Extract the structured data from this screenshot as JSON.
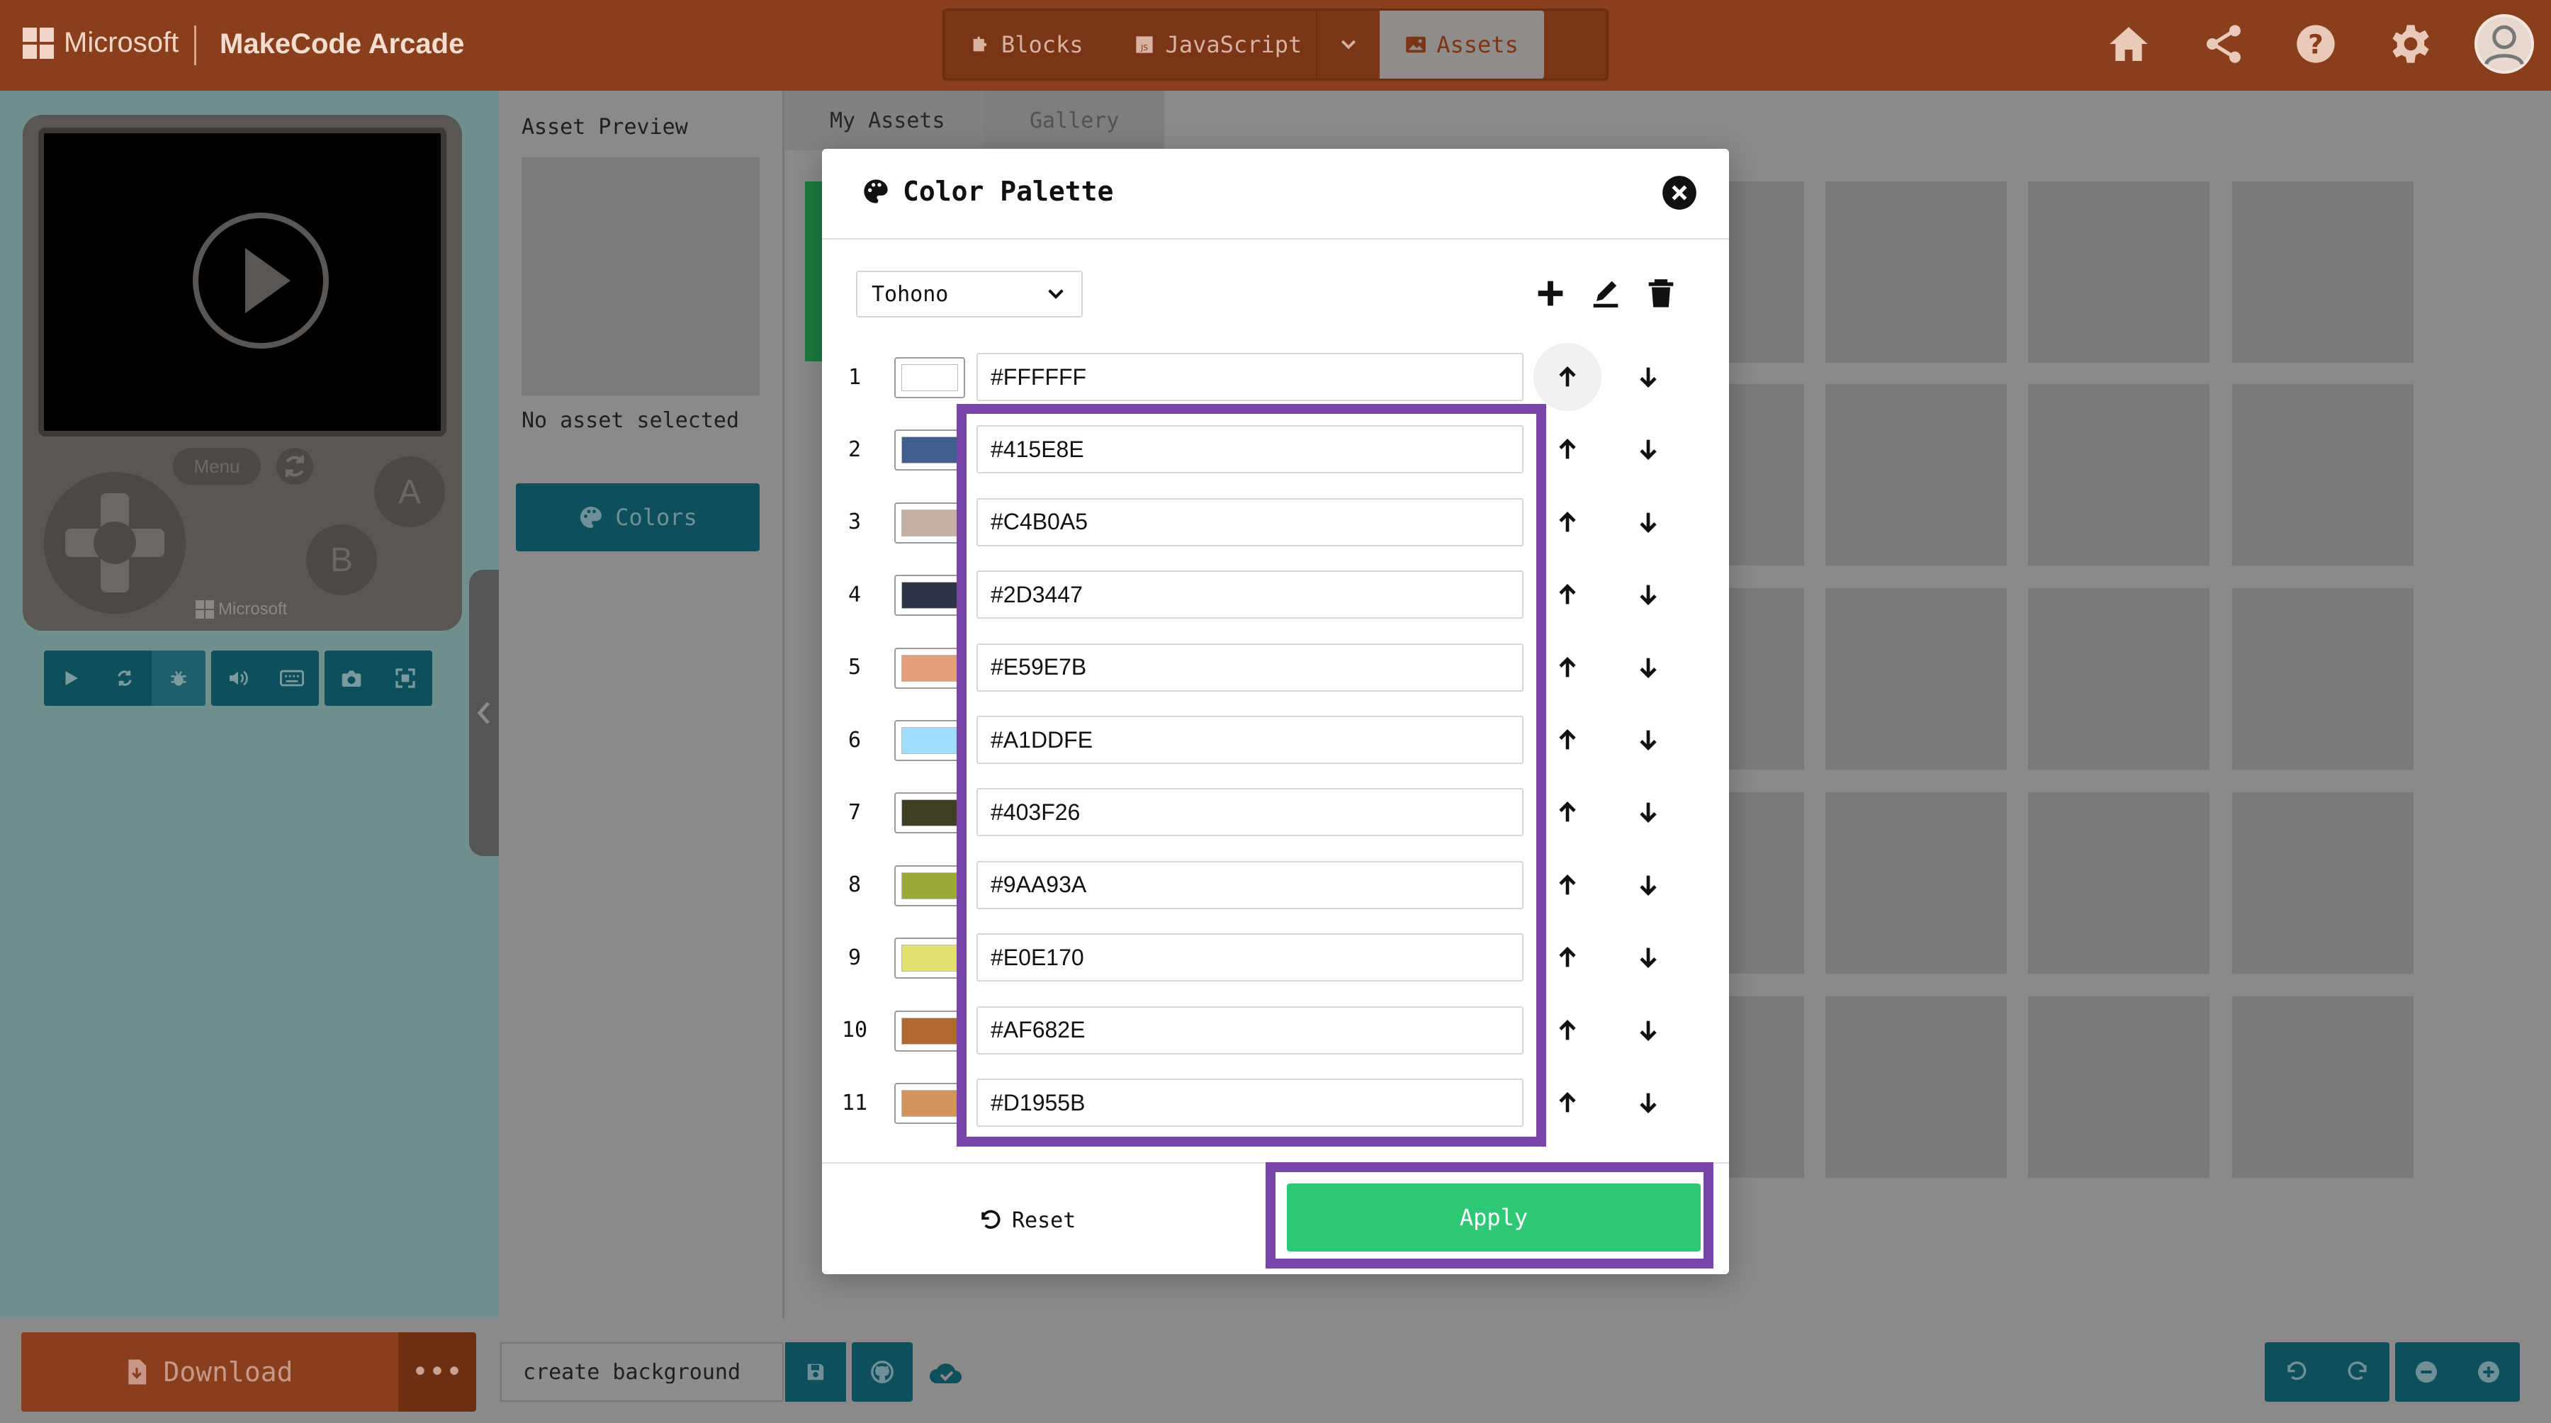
{
  "topbar": {
    "ms_label": "Microsoft",
    "brand": "MakeCode Arcade",
    "tabs": [
      {
        "label": "Blocks",
        "icon": "puzzle-icon"
      },
      {
        "label": "JavaScript",
        "icon": "js-icon"
      },
      {
        "label": "Assets",
        "icon": "image-icon"
      }
    ],
    "active_tab": "Assets",
    "icons": [
      "home-icon",
      "share-icon",
      "help-icon",
      "gear-icon",
      "avatar-icon"
    ]
  },
  "simulator": {
    "menu_label": "Menu",
    "a_label": "A",
    "b_label": "B",
    "brand": "Microsoft",
    "toolbar_icons": [
      "play-icon",
      "restart-icon",
      "bug-icon",
      "volume-icon",
      "keyboard-icon",
      "camera-icon",
      "fullscreen-icon"
    ]
  },
  "asset_sidebar": {
    "preview_title": "Asset Preview",
    "empty_text": "No asset selected",
    "colors_button": "Colors"
  },
  "gallery": {
    "tabs": [
      "My Assets",
      "Gallery"
    ],
    "active_tab": "My Assets"
  },
  "bottombar": {
    "download_label": "Download",
    "more_label": "•••",
    "project_name": "create background"
  },
  "modal": {
    "title": "Color Palette",
    "palette_name": "Tohono",
    "rows": [
      {
        "num": "1",
        "hex": "#FFFFFF"
      },
      {
        "num": "2",
        "hex": "#415E8E"
      },
      {
        "num": "3",
        "hex": "#C4B0A5"
      },
      {
        "num": "4",
        "hex": "#2D3447"
      },
      {
        "num": "5",
        "hex": "#E59E7B"
      },
      {
        "num": "6",
        "hex": "#A1DDFE"
      },
      {
        "num": "7",
        "hex": "#403F26"
      },
      {
        "num": "8",
        "hex": "#9AA93A"
      },
      {
        "num": "9",
        "hex": "#E0E170"
      },
      {
        "num": "10",
        "hex": "#AF682E"
      },
      {
        "num": "11",
        "hex": "#D1955B"
      }
    ],
    "reset_label": "Reset",
    "apply_label": "Apply"
  },
  "colors": {
    "topbar": "#8a3f1c",
    "apply": "#2ec876",
    "teal_button": "#0e4f5c",
    "highlight": "#7a45a8"
  }
}
